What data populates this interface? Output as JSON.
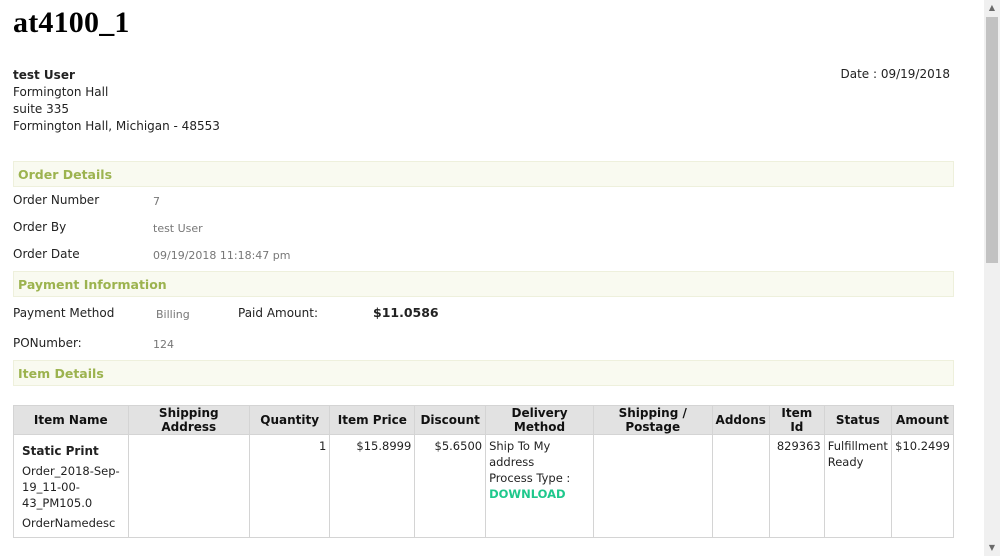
{
  "title": "at4100_1",
  "customer": {
    "name": "test User",
    "address_line1": "Formington Hall",
    "address_line2": "suite 335",
    "address_line3": "Formington Hall, Michigan - 48553"
  },
  "date_label": "Date : 09/19/2018",
  "sections": {
    "order_details": "Order Details",
    "payment_information": "Payment Information",
    "item_details": "Item Details"
  },
  "order": {
    "number_label": "Order Number",
    "number_value": "7",
    "by_label": "Order By",
    "by_value": "test User",
    "date_label": "Order Date",
    "date_value": "09/19/2018 11:18:47 pm"
  },
  "payment": {
    "method_label": "Payment Method",
    "method_value": "Billing",
    "paid_label": "Paid Amount:",
    "paid_value": "$11.0586",
    "po_label": "PONumber:",
    "po_value": "124"
  },
  "table": {
    "headers": [
      "Item Name",
      "Shipping Address",
      "Quantity",
      "Item Price",
      "Discount",
      "Delivery Method",
      "Shipping / Postage",
      "Addons",
      "Item Id",
      "Status",
      "Amount"
    ],
    "row": {
      "item_name": "Static Print",
      "item_file": "Order_2018-Sep-19_11-00-43_PM105.0",
      "item_desc": "OrderNamedesc",
      "shipping_address": "",
      "quantity": "1",
      "item_price": "$15.8999",
      "discount": "$5.6500",
      "delivery_line1": "Ship To My address",
      "delivery_line2": "Process Type :",
      "delivery_type": "DOWNLOAD",
      "shipping_postage": "",
      "addons": "",
      "item_id": "829363",
      "status": "Fulfillment Ready",
      "amount": "$10.2499"
    }
  },
  "colors": {
    "section_text": "#9cb34f",
    "section_bg": "#f9faf0",
    "header_bg": "#e2e2e2",
    "download": "#1ec88c"
  },
  "icons": {
    "scroll_up": "▲",
    "scroll_down": "▼"
  }
}
